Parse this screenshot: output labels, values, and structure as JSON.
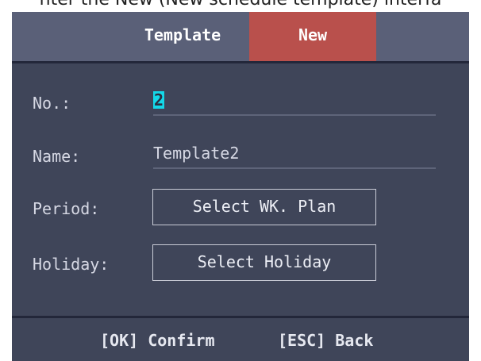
{
  "page": {
    "caption": "nter the New (New schedule template) interfa"
  },
  "tabs": {
    "template_label": "Template",
    "new_label": "New"
  },
  "form": {
    "no_label": "No.:",
    "no_value": "2",
    "name_label": "Name:",
    "name_value": "Template2",
    "period_label": "Period:",
    "period_button": "Select WK. Plan",
    "holiday_label": "Holiday:",
    "holiday_button": "Select Holiday"
  },
  "footer": {
    "confirm": "[OK] Confirm",
    "back": "[ESC] Back"
  },
  "colors": {
    "panel": "#3f4559",
    "tab_bar": "#5a6078",
    "active_tab": "#b9504c",
    "cursor": "#14d8e8"
  }
}
